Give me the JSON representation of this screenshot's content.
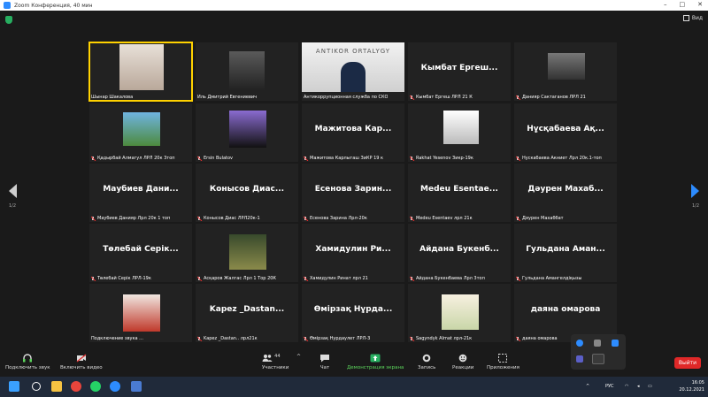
{
  "window": {
    "title": "Zoom Конференция, 40 мин"
  },
  "view_button": {
    "label": "Вид"
  },
  "pagination": {
    "left": "1/2",
    "right": "1/2"
  },
  "tiles": [
    {
      "name": "",
      "label": "Шынар Шакалова",
      "muted": false,
      "active": true
    },
    {
      "name": "",
      "label": "Иль Дмитрий Евгениевич",
      "muted": false,
      "active": false
    },
    {
      "name": "",
      "label": "Антикоррупционная служба по СКО",
      "muted": false,
      "active": false,
      "photo_text": "ANTIKOR ORTALYGY"
    },
    {
      "name": "Кымбат Ергеш...",
      "label": "Кымбат Ергеш ЛРЛ 21 К",
      "muted": true,
      "active": false
    },
    {
      "name": "",
      "label": "Данияр Сактаганов ЛРЛ 21",
      "muted": true,
      "active": false
    },
    {
      "name": "",
      "label": "Қадырбай Алмагул ЛРЛ 20к 3топ",
      "muted": true,
      "active": false
    },
    {
      "name": "",
      "label": "Ersin Bulatov",
      "muted": true,
      "active": false
    },
    {
      "name": "Мажитова Кар...",
      "label": "Мажитова Карлыгаш ЗиКР 19 к",
      "muted": true,
      "active": false
    },
    {
      "name": "",
      "label": "Rakhat Yesenov Зикр-19к",
      "muted": true,
      "active": false
    },
    {
      "name": "Нұсқабаева Ақ...",
      "label": "Нускабаева Акниет Лрл 20к.1-топ",
      "muted": true,
      "active": false
    },
    {
      "name": "Маубиев Дани...",
      "label": "Маубиев Данияр Лрл 20к 1 топ",
      "muted": true,
      "active": false
    },
    {
      "name": "Конысов Диас...",
      "label": "Конысов Диас ЛРЛ20к-1",
      "muted": true,
      "active": false
    },
    {
      "name": "Есенова Зарин...",
      "label": "Есенова Зарина Лрл-20к",
      "muted": true,
      "active": false
    },
    {
      "name": "Medeu Esentae...",
      "label": "Medeu Esentaev лрл 21к",
      "muted": true,
      "active": false
    },
    {
      "name": "Дәурен Махаб...",
      "label": "Дәурен Махаббат",
      "muted": true,
      "active": false
    },
    {
      "name": "Төлебай Серік...",
      "label": "Төлебай Серік ЛРЛ-19к",
      "muted": true,
      "active": false
    },
    {
      "name": "",
      "label": "Асқаров Жалгас Лрл 1 Тор 20К",
      "muted": true,
      "active": false
    },
    {
      "name": "Хамидулин Ри...",
      "label": "Хамидулин Ринат лрл 21",
      "muted": true,
      "active": false
    },
    {
      "name": "Айдана Букенб...",
      "label": "Айдана Букенбаева Лрл 3топ",
      "muted": true,
      "active": false
    },
    {
      "name": "Гульдана Аман...",
      "label": "Гульдана Амангелдіқызы",
      "muted": true,
      "active": false
    },
    {
      "name": "",
      "label": "Подключение звука ...",
      "muted": false,
      "active": false
    },
    {
      "name": "Kapez _Dastan...",
      "label": "Kapez _Dastan.. лрл21к",
      "muted": true,
      "active": false
    },
    {
      "name": "Өмірзақ Нұрда...",
      "label": "Өмірзақ Нурдаулет ЛРЛ-3",
      "muted": true,
      "active": false
    },
    {
      "name": "",
      "label": "Sagyndyk Almat лрл-21к",
      "muted": true,
      "active": false
    },
    {
      "name": "даяна омарова",
      "label": "даяна омарова",
      "muted": true,
      "active": false
    }
  ],
  "toolbar": {
    "audio": "Подключить звук",
    "video": "Включить видео",
    "participants": "Участники",
    "participants_count": "44",
    "chat": "Чат",
    "share": "Демонстрация экрана",
    "record": "Запись",
    "reactions": "Реакции",
    "apps": "Приложения",
    "leave": "Выйти"
  },
  "taskbar": {
    "lang": "РУС",
    "time": "16:05",
    "date": "20.12.2021"
  },
  "colors": {
    "accent": "#2d8cff",
    "leave": "#e02828",
    "active_speaker": "#ffd200"
  }
}
